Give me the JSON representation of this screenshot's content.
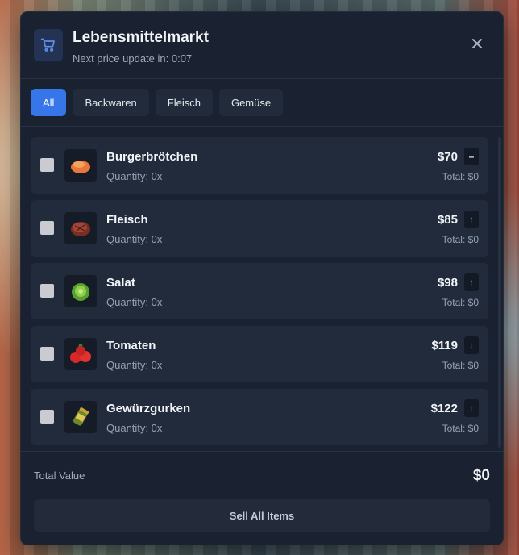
{
  "header": {
    "title": "Lebensmittelmarkt",
    "subtitle": "Next price update in: 0:07"
  },
  "tabs": [
    {
      "label": "All",
      "active": true
    },
    {
      "label": "Backwaren",
      "active": false
    },
    {
      "label": "Fleisch",
      "active": false
    },
    {
      "label": "Gemüse",
      "active": false
    }
  ],
  "items": [
    {
      "name": "Burgerbrötchen",
      "quantity": "Quantity: 0x",
      "price": "$70",
      "trend": "–",
      "total": "Total: $0",
      "icon": "burger-bun-icon"
    },
    {
      "name": "Fleisch",
      "quantity": "Quantity: 0x",
      "price": "$85",
      "trend": "↑",
      "total": "Total: $0",
      "icon": "steak-icon"
    },
    {
      "name": "Salat",
      "quantity": "Quantity: 0x",
      "price": "$98",
      "trend": "↑",
      "total": "Total: $0",
      "icon": "lettuce-icon"
    },
    {
      "name": "Tomaten",
      "quantity": "Quantity: 0x",
      "price": "$119",
      "trend": "↓",
      "total": "Total: $0",
      "icon": "tomato-icon"
    },
    {
      "name": "Gewürzgurken",
      "quantity": "Quantity: 0x",
      "price": "$122",
      "trend": "↑",
      "total": "Total: $0",
      "icon": "pickle-jar-icon"
    }
  ],
  "footer": {
    "total_label": "Total Value",
    "total_value": "$0",
    "sell_button": "Sell All Items"
  },
  "colors": {
    "accent": "#3776e8",
    "trend_up": "#3cc46a",
    "trend_down": "#e24d4d",
    "trend_flat": "#e4e8ee"
  }
}
